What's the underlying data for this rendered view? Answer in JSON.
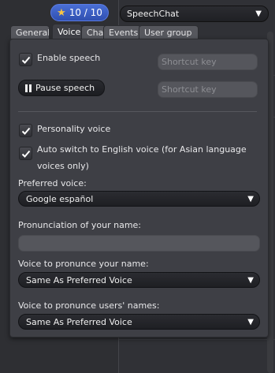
{
  "header": {
    "points_text": "10 / 10",
    "mode_value": "SpeechChat",
    "icons": {
      "points": "star-icon",
      "dropdown": "chevron-down-icon"
    },
    "badge_color": "#3c60c8"
  },
  "tabs": [
    {
      "label": "General",
      "active": false
    },
    {
      "label": "Voice",
      "active": true
    },
    {
      "label": "Chat",
      "active": false
    },
    {
      "label": "Events",
      "active": false
    },
    {
      "label": "User group",
      "active": false
    }
  ],
  "voice": {
    "enable_speech": {
      "label": "Enable speech",
      "checked": true,
      "shortcut_placeholder": "Shortcut key"
    },
    "pause_speech": {
      "label": "Pause speech",
      "icon": "pause-icon",
      "shortcut_placeholder": "Shortcut key"
    },
    "personality_voice": {
      "label": "Personality voice",
      "checked": true
    },
    "auto_switch": {
      "label_line1": "Auto switch to English voice (for Asian language",
      "label_line2": "voices only)",
      "checked": true
    },
    "preferred_voice": {
      "label": "Preferred voice:",
      "value": "Google español"
    },
    "pronunciation": {
      "label": "Pronunciation of your name:",
      "value": ""
    },
    "voice_your_name": {
      "label": "Voice to pronunce your name:",
      "value": "Same As Preferred Voice"
    },
    "voice_users_names": {
      "label": "Voice to pronunce users' names:",
      "value": "Same As Preferred Voice"
    }
  }
}
